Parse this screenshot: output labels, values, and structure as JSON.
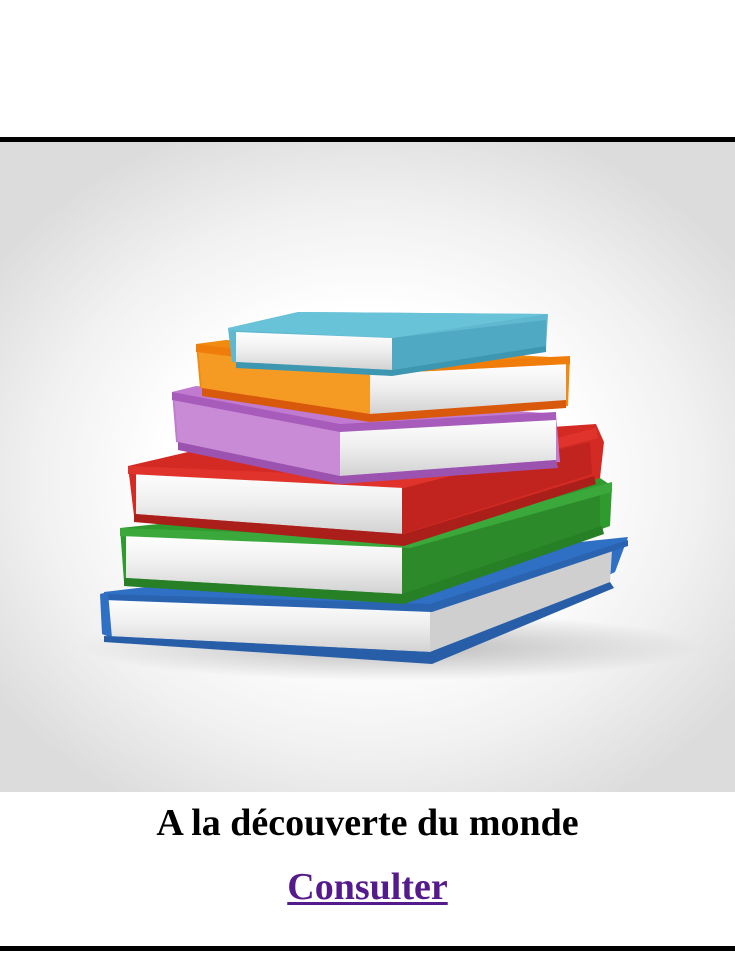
{
  "card": {
    "title": "A la découverte du monde",
    "link_label": "Consulter"
  },
  "illustration": {
    "icon": "stack-of-books-icon",
    "book_colors": [
      "#2f6fc4",
      "#2f9a2e",
      "#d42a24",
      "#c07ad0",
      "#f08a10",
      "#5fb8cf"
    ]
  },
  "colors": {
    "link": "#551a8b",
    "border": "#000000"
  }
}
